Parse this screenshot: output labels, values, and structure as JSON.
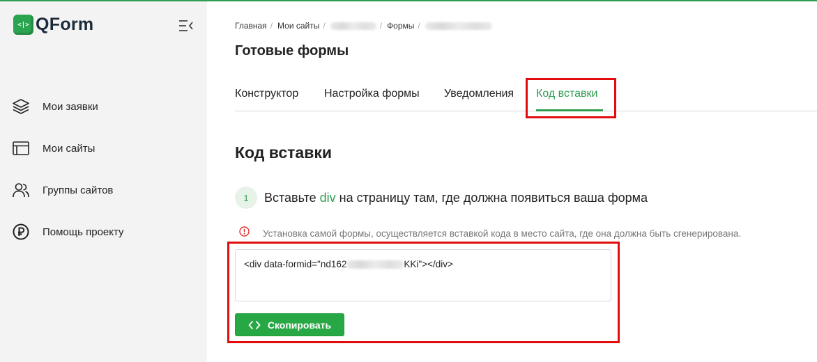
{
  "app": {
    "name": "QForm",
    "logo_glyph": "<|>"
  },
  "colors": {
    "accent": "#2e9d4f",
    "highlight": "#e10d0d",
    "sidebar_bg": "#f3f3f3"
  },
  "sidebar": {
    "collapse_icon": "collapse-menu-icon",
    "items": [
      {
        "label": "Мои заявки",
        "icon": "layers-icon"
      },
      {
        "label": "Мои сайты",
        "icon": "browser-window-icon"
      },
      {
        "label": "Группы сайтов",
        "icon": "users-icon"
      },
      {
        "label": "Помощь проекту",
        "icon": "ruble-coin-icon"
      }
    ]
  },
  "breadcrumb": [
    "Главная",
    "Мои сайты",
    "Формы"
  ],
  "page_title": "Готовые формы",
  "tabs": [
    {
      "label": "Конструктор",
      "active": false
    },
    {
      "label": "Настройка формы",
      "active": false
    },
    {
      "label": "Уведомления",
      "active": false
    },
    {
      "label": "Код вставки",
      "active": true
    }
  ],
  "section_title": "Код вставки",
  "step": {
    "number": "1",
    "text_before": "Вставьте ",
    "highlight": "div",
    "text_after": " на страницу там, где должна появиться ваша форма"
  },
  "note": {
    "icon": "info-circle-icon",
    "text": "Установка самой формы, осуществляется вставкой кода в место сайта, где она должна быть сгенерирована."
  },
  "code": {
    "prefix": "<div data-formid=\"nd162",
    "suffix": "KKi\"></div>"
  },
  "copy_button": {
    "label": "Скопировать",
    "icon": "code-brackets-icon"
  }
}
